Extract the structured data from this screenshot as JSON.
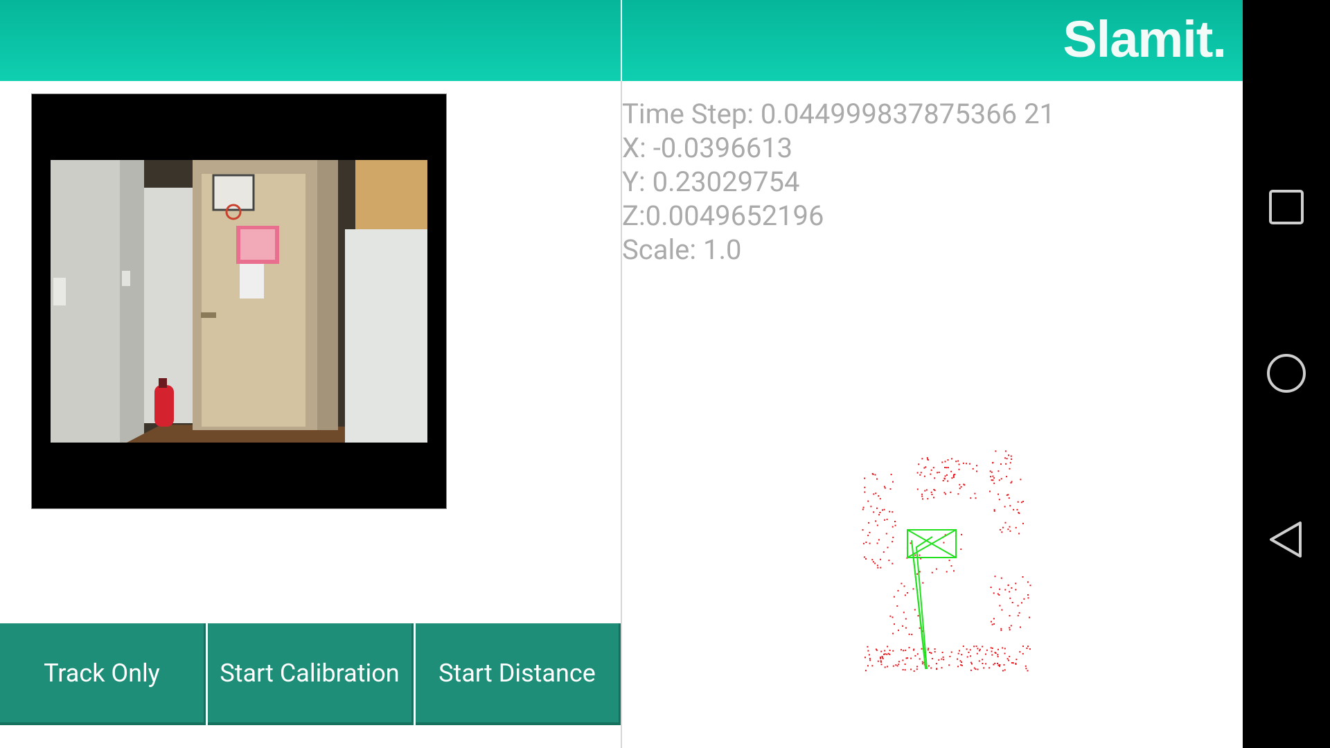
{
  "app": {
    "title": "Slamit."
  },
  "camera": {
    "description_label": "camera-preview"
  },
  "buttons": {
    "track_only": "Track Only",
    "start_calibration": "Start Calibration",
    "start_distance": "Start Distance"
  },
  "readout": {
    "time_step": "Time Step: 0.044999837875366 21",
    "x": "X: -0.0396613",
    "y": "Y: 0.23029754",
    "z": "Z:0.0049652196",
    "scale": "Scale: 1.0"
  },
  "map": {
    "point_color": "#e8141b",
    "trajectory_color": "#22e01e"
  },
  "colors": {
    "header": "#0bc3a5",
    "button": "#1e8e78"
  },
  "navigation": {
    "icons": [
      "square-recents-icon",
      "circle-home-icon",
      "triangle-back-icon"
    ]
  }
}
